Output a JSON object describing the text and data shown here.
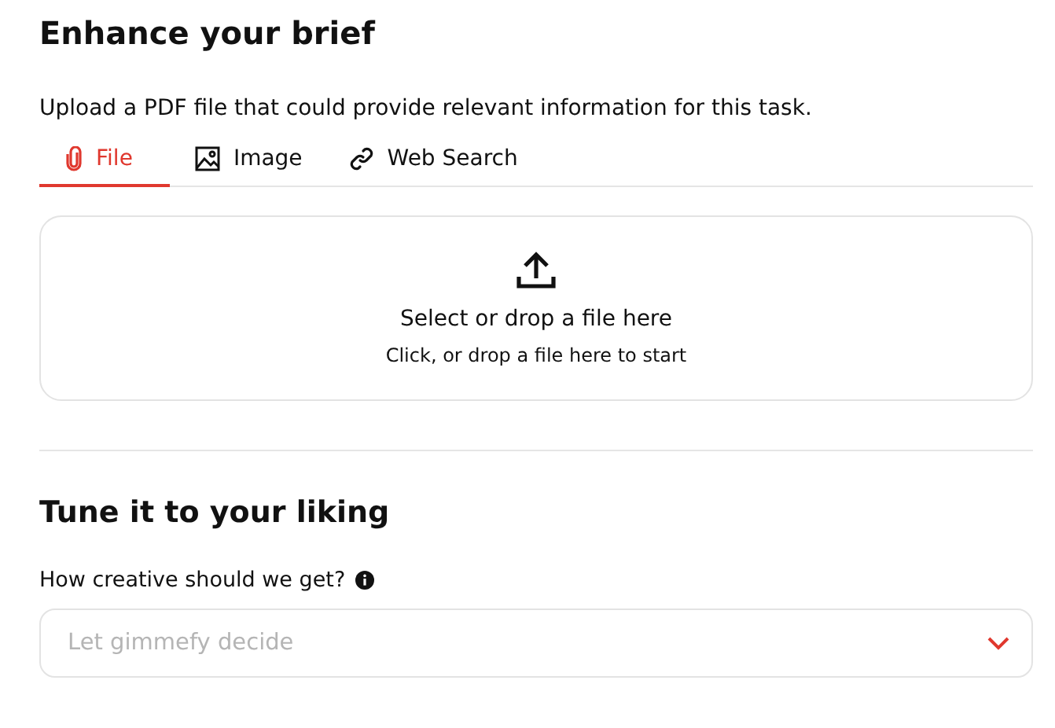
{
  "brief": {
    "title": "Enhance your brief",
    "description": "Upload a PDF file that could provide relevant information for this task.",
    "tabs": [
      {
        "kind": "file",
        "label": "File",
        "selected": true
      },
      {
        "kind": "image",
        "label": "Image",
        "selected": false
      },
      {
        "kind": "link",
        "label": "Web Search",
        "selected": false
      }
    ],
    "dropzone": {
      "title": "Select or drop a file here",
      "hint": "Click, or drop a file here to start"
    }
  },
  "tune": {
    "title": "Tune it to your liking",
    "field_label": "How creative should we get?",
    "select": {
      "placeholder": "Let gimmefy decide"
    }
  }
}
